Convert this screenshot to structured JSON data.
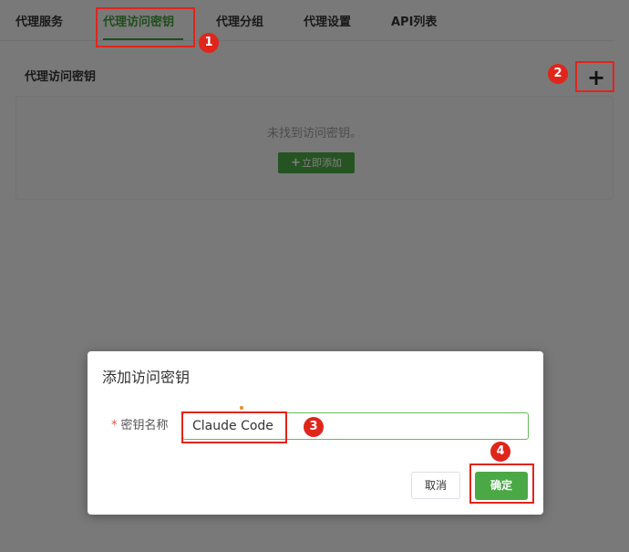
{
  "tabs": [
    {
      "label": "代理服务",
      "active": false
    },
    {
      "label": "代理访问密钥",
      "active": true
    },
    {
      "label": "代理分组",
      "active": false
    },
    {
      "label": "代理设置",
      "active": false
    },
    {
      "label": "API列表",
      "active": false
    }
  ],
  "section": {
    "title": "代理访问密钥",
    "add_icon": "plus-icon",
    "empty_text": "未找到访问密钥。",
    "add_now_label": "立即添加"
  },
  "dialog": {
    "title": "添加访问密钥",
    "required_mark": "*",
    "field_label": "密钥名称",
    "field_value": "Claude Code",
    "cancel_label": "取消",
    "ok_label": "确定"
  },
  "annotations": {
    "markers": [
      "1",
      "2",
      "3",
      "4"
    ],
    "highlight_color": "#e0251b"
  },
  "colors": {
    "accent": "#4aa845"
  }
}
